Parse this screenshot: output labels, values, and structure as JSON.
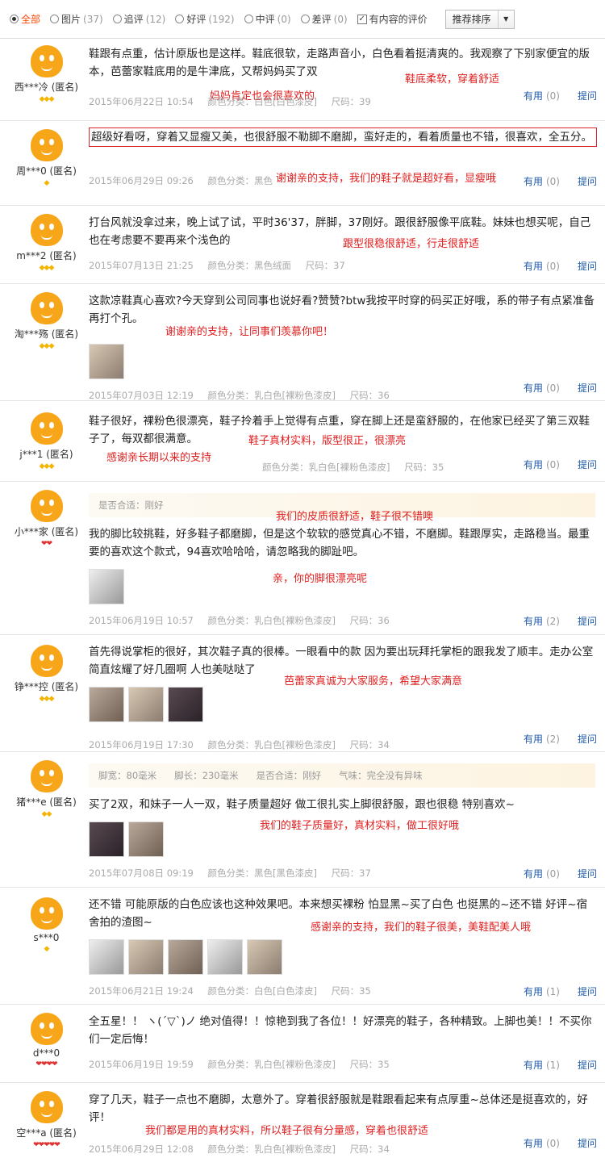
{
  "filters": [
    {
      "label": "全部",
      "count": "",
      "active": true
    },
    {
      "label": "图片",
      "count": "(37)"
    },
    {
      "label": "追评",
      "count": "(12)"
    },
    {
      "label": "好评",
      "count": "(192)"
    },
    {
      "label": "中评",
      "count": "(0)"
    },
    {
      "label": "差评",
      "count": "(0)"
    }
  ],
  "content_filter": {
    "label": "有内容的评价",
    "checked": true
  },
  "sort": {
    "label": "推荐排序"
  },
  "labels": {
    "useful": "有用",
    "ask": "提问"
  },
  "reviews": [
    {
      "user": "西***冷 (匿名)",
      "badge": "◆◆◆",
      "badge_color": "gold",
      "text": "鞋跟有点重，估计原版也是这样。鞋底很软，走路声音小，白色看着挺清爽的。我观察了下别家便宜的版本，芭蕾家鞋底用的是牛津底，又帮妈妈买了双",
      "annotations": [
        "鞋底柔软，穿着舒适",
        "妈妈肯定也会很喜欢的"
      ],
      "date": "2015年06月22日 10:54",
      "color_spec": "颜色分类：白色[白色漆皮]",
      "size": "尺码：39",
      "useful_count": "(0)"
    },
    {
      "user": "周***0 (匿名)",
      "badge": "◆",
      "badge_color": "gold",
      "text": "超级好看呀，穿着又显瘦又美，也很舒服不勒脚不磨脚，蛮好走的，看着质量也不错，很喜欢，全五分。",
      "annotations": [
        "谢谢亲的支持，我们的鞋子就是超好看，显瘦哦"
      ],
      "date": "2015年06月29日 09:26",
      "color_spec": "颜色分类：黑色",
      "size": "",
      "useful_count": "(0)"
    },
    {
      "user": "m***2 (匿名)",
      "badge": "◆◆◆",
      "badge_color": "gold",
      "text": "打台风就没拿过来，晚上试了试，平时36'37，胖脚，37刚好。跟很舒服像平底鞋。妹妹也想买呢，自己也在考虑要不要再来个浅色的",
      "annotations": [
        "跟型很稳很舒适，行走很舒适"
      ],
      "date": "2015年07月13日 21:25",
      "color_spec": "颜色分类：黑色绒面",
      "size": "尺码：37",
      "useful_count": "(0)"
    },
    {
      "user": "淘***殇 (匿名)",
      "badge": "◆◆◆",
      "badge_color": "gold",
      "text": "这款凉鞋真心喜欢?今天穿到公司同事也说好看?赞赞?btw我按平时穿的码买正好哦，系的带子有点紧准备再打个孔。",
      "annotations": [
        "谢谢亲的支持，让同事们羡慕你吧！"
      ],
      "date": "2015年07月03日 12:19",
      "color_spec": "颜色分类：乳白色[裸粉色漆皮]",
      "size": "尺码：36",
      "useful_count": "(0)"
    },
    {
      "user": "j***1 (匿名)",
      "badge": "◆◆◆",
      "badge_color": "gold",
      "text": "鞋子很好，裸粉色很漂亮，鞋子拎着手上觉得有点重，穿在脚上还是蛮舒服的，在他家已经买了第三双鞋子了，每双都很满意。",
      "annotations": [
        "鞋子真材实料，版型很正，很漂亮",
        "感谢亲长期以来的支持"
      ],
      "date": "2015年07月03日 11:24",
      "color_spec": "颜色分类：乳白色[裸粉色漆皮]",
      "size": "尺码：35",
      "useful_count": "(0)"
    },
    {
      "user": "小***家 (匿名)",
      "badge": "❤❤",
      "badge_color": "red",
      "attrs": [
        "是否合适：刚好"
      ],
      "text": "我的脚比较挑鞋，好多鞋子都磨脚，但是这个软软的感觉真心不错，不磨脚。鞋跟厚实，走路稳当。最重要的喜欢这个款式，94喜欢哈哈哈，请忽略我的脚趾吧。",
      "annotations": [
        "我们的皮质很舒适，鞋子很不错噢",
        "亲，你的脚很漂亮呢"
      ],
      "date": "2015年06月19日 10:57",
      "color_spec": "颜色分类：乳白色[裸粉色漆皮]",
      "size": "尺码：36",
      "useful_count": "(2)"
    },
    {
      "user": "铮***控 (匿名)",
      "badge": "◆◆◆",
      "badge_color": "gold",
      "text": "首先得说掌柜的很好，其次鞋子真的很棒。一眼看中的款 因为要出玩拜托掌柜的跟我发了顺丰。走办公室简直炫耀了好几圈啊 人也美哒哒了",
      "annotations": [
        "芭蕾家真诚为大家服务，希望大家满意"
      ],
      "date": "2015年06月19日 17:30",
      "color_spec": "颜色分类：乳白色[裸粉色漆皮]",
      "size": "尺码：34",
      "useful_count": "(2)"
    },
    {
      "user": "猪***e (匿名)",
      "badge": "◆◆",
      "badge_color": "gold",
      "attrs": [
        "脚宽：80毫米",
        "脚长：230毫米",
        "是否合适：刚好",
        "气味：完全没有异味"
      ],
      "text": "买了2双，和妹子一人一双，鞋子质量超好 做工很扎实上脚很舒服，跟也很稳 特别喜欢~",
      "annotations": [
        "我们的鞋子质量好，真材实料，做工很好哦"
      ],
      "date": "2015年07月08日 09:19",
      "color_spec": "颜色分类：黑色[黑色漆皮]",
      "size": "尺码：37",
      "useful_count": "(0)"
    },
    {
      "user": "s***0",
      "badge": "◆",
      "badge_color": "gold",
      "text": "还不错 可能原版的白色应该也这种效果吧。本来想买裸粉 怕显黑~买了白色 也挺黑的~还不错 好评~宿舍拍的渣图~",
      "annotations": [
        "感谢亲的支持，我们的鞋子很美，美鞋配美人哦"
      ],
      "date": "2015年06月21日 19:24",
      "color_spec": "颜色分类：白色[白色漆皮]",
      "size": "尺码：35",
      "useful_count": "(1)"
    },
    {
      "user": "d***0",
      "badge": "❤❤❤❤",
      "badge_color": "red",
      "text": "全五星！！ ヽ(´▽`)ノ 绝对值得！！惊艳到我了各位！！好漂亮的鞋子，各种精致。上脚也美！！不买你们一定后悔！",
      "annotations": [],
      "date": "2015年06月19日 19:59",
      "color_spec": "颜色分类：乳白色[裸粉色漆皮]",
      "size": "尺码：35",
      "useful_count": "(1)"
    },
    {
      "user": "空***a (匿名)",
      "badge": "❤❤❤❤❤",
      "badge_color": "red",
      "text": "穿了几天，鞋子一点也不磨脚，太意外了。穿着很舒服就是鞋跟看起来有点厚重~总体还是挺喜欢的，好评！",
      "annotations": [
        "我们都是用的真材实料，所以鞋子很有分量感，穿着也很舒适"
      ],
      "date": "2015年06月29日 12:08",
      "color_spec": "颜色分类：乳白色[裸粉色漆皮]",
      "size": "尺码：34",
      "useful_count": "(0)"
    }
  ]
}
